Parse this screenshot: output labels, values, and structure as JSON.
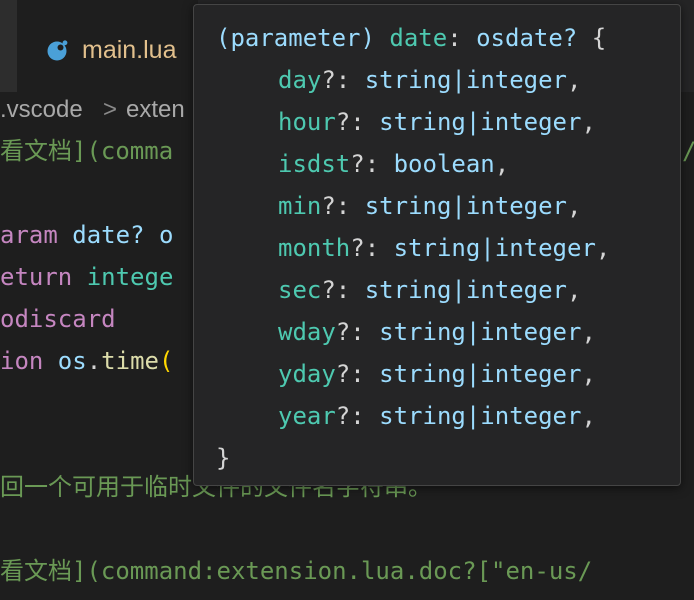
{
  "tab": {
    "label": "main.lua",
    "icon": "lua-file-icon"
  },
  "breadcrumb": {
    "segment1": ".vscode",
    "separator": ">",
    "segment2": "exten"
  },
  "editor": {
    "line1_cn": "看文档",
    "line1_rest": "](comma",
    "line3_param": "aram",
    "line3_rest": " date? o",
    "line4_kw": "eturn",
    "line4_type": " intege",
    "line5": "odiscard",
    "line6_kw": "ion",
    "line6_obj": " os",
    "line6_dot": ".",
    "line6_fn": "time",
    "line6_paren": "(",
    "line8_cn": "回一个可用于临时文件的文件名字符串。",
    "line10_cn": "看文档",
    "line10_rest": "](command:extension.lua.doc?[\"en-us/",
    "right_edge_fragment": "/"
  },
  "hover": {
    "header_open": "(parameter)",
    "header_name": "date",
    "header_colon": ":",
    "header_type": "osdate?",
    "header_brace": "{",
    "fields": [
      {
        "name": "day",
        "type": "string|integer"
      },
      {
        "name": "hour",
        "type": "string|integer"
      },
      {
        "name": "isdst",
        "type": "boolean"
      },
      {
        "name": "min",
        "type": "string|integer"
      },
      {
        "name": "month",
        "type": "string|integer"
      },
      {
        "name": "sec",
        "type": "string|integer"
      },
      {
        "name": "wday",
        "type": "string|integer"
      },
      {
        "name": "yday",
        "type": "string|integer"
      },
      {
        "name": "year",
        "type": "string|integer"
      }
    ],
    "field_suffix": "?:",
    "field_comma": ",",
    "close_brace": "}"
  },
  "colors": {
    "editor_bg": "#1e1e1e",
    "hover_bg": "#252526",
    "tab_label": "#e2c08d",
    "field_name": "#4ec9b0",
    "field_type": "#9cdcfe",
    "comment_green": "#6a9955"
  }
}
